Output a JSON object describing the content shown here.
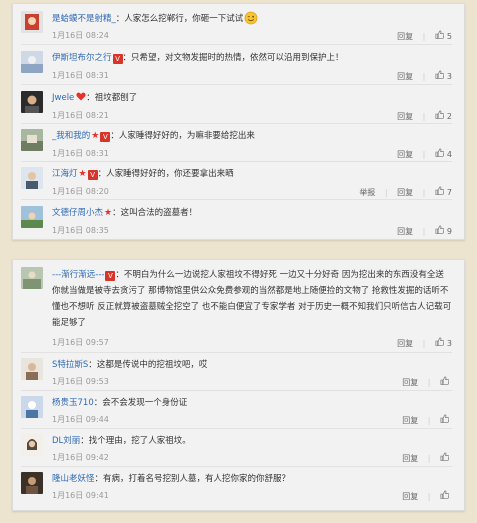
{
  "card1": {
    "comments": [
      {
        "user": "是蛤蟆不是射精_",
        "sep": "：",
        "text": "人家怎么挖郸行，你砸一下试试",
        "emoji": "winking-smile-icon",
        "date": "1月16日 08:24",
        "like_count": "5",
        "badges": []
      },
      {
        "user": "伊斯坦布尔之行",
        "sep": "：",
        "text": "只希望，对文物发掘时的热情，依然可以沿用到保护上！",
        "date": "1月16日 08:31",
        "like_count": "3",
        "badges": [
          "v"
        ]
      },
      {
        "user": "Jwele",
        "sep": "：",
        "text": "祖坟都刨了",
        "date": "1月16日 08:21",
        "like_count": "2",
        "badges": [
          "heart"
        ]
      },
      {
        "user": "_我和我的",
        "sep": "：",
        "text": "人家睡得好好的，为嘛非要给挖出来",
        "date": "1月16日 08:31",
        "like_count": "4",
        "badges": [
          "star",
          "v"
        ]
      },
      {
        "user": "江海灯",
        "sep": "：",
        "text": "人家睡得好好的，你还要拿出来晒",
        "date": "1月16日 08:20",
        "like_count": "7",
        "badges": [
          "star",
          "v"
        ],
        "report": "举报"
      },
      {
        "user": "文德仔周小杰",
        "sep": "：",
        "text": "这叫合法的盗墓者！",
        "date": "1月16日 08:35",
        "like_count": "9",
        "badges": [
          "star"
        ]
      }
    ]
  },
  "card2": {
    "comments": [
      {
        "user": "---渐行渐远---",
        "sep": "：",
        "text": "不明白为什么一边说挖人家祖坟不得好死 一边又十分好奇 因为挖出来的东西没有全送你就当做是被寺去贪污了 那博物馆里供公众免费参观的当然都是地上随便捡的文物了 抢救性发掘的话听不懂也不想听 反正就算被盗墓贼全挖空了 也不能白便宜了专家学者 对于历史一概不知我们只听信古人记载可能足够了",
        "date": "1月16日 09:57",
        "like_count": "3",
        "badges": [
          "v"
        ]
      },
      {
        "user": "S特拉斯S",
        "sep": "：",
        "text": "这都是传说中的挖祖坟吧，哎",
        "date": "1月16日 09:53",
        "badges": []
      },
      {
        "user": "杨贵玉710",
        "sep": "：",
        "text": "会不会发现一个身份证",
        "date": "1月16日 09:44",
        "badges": []
      },
      {
        "user": "DL刘丽",
        "sep": "：",
        "text": "找个理由，挖了人家祖坟。",
        "date": "1月16日 09:42",
        "badges": []
      },
      {
        "user": "隆山老妖怪",
        "sep": "：",
        "text": "有病，打着名号挖别人墓，有人挖你家的你舒服？",
        "date": "1月16日 09:41",
        "badges": []
      }
    ]
  },
  "labels": {
    "reply": "回复",
    "v_badge": "V"
  },
  "colors": {
    "username": "#2e69b6",
    "badge": "#d8352a",
    "background": "#ece4cf"
  }
}
